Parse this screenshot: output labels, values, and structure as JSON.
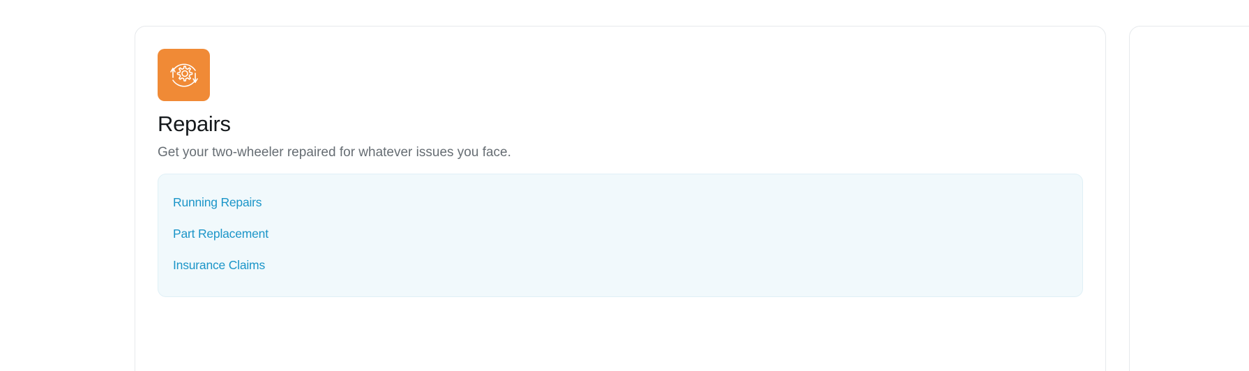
{
  "card": {
    "icon": "repair-gear-cycle-icon",
    "icon_color": "#f08a36",
    "title": "Repairs",
    "description": "Get your two-wheeler repaired for whatever issues you face.",
    "links": [
      {
        "label": "Running Repairs"
      },
      {
        "label": "Part Replacement"
      },
      {
        "label": "Insurance Claims"
      }
    ]
  },
  "colors": {
    "link": "#1b95c8",
    "panel_bg": "#f1f9fc",
    "title": "#15191c",
    "description": "#666d73"
  }
}
